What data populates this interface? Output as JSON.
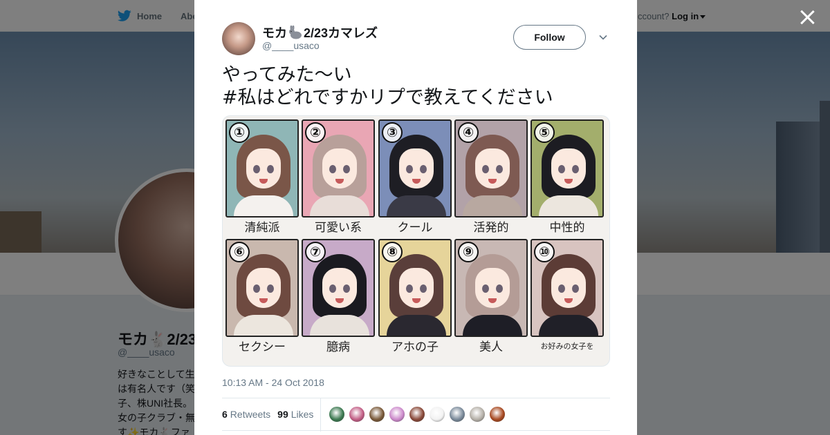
{
  "topbar": {
    "home_label": "Home",
    "about_label": "Abo",
    "login_prompt": "ccount?",
    "login_label": "Log in"
  },
  "profile": {
    "name": "モカ🐇2/23",
    "handle": "@____usaco",
    "bio_lines": [
      "好きなことして生",
      "は有名人です（笑",
      "子、株UNI社長。",
      "女の子クラブ・無",
      "す✨モカ🐇ファ"
    ]
  },
  "tweet": {
    "author_name_prefix": "モカ",
    "author_name_suffix": "2/23カマレズ",
    "author_handle": "@____usaco",
    "follow_label": "Follow",
    "text_line1": "やってみた〜い",
    "text_line2": "#私はどれですかリプで教えてください",
    "timestamp": "10:13 AM - 24 Oct 2018",
    "retweets_count": "6",
    "retweets_label": "Retweets",
    "likes_count": "99",
    "likes_label": "Likes"
  },
  "media": {
    "panels": [
      {
        "num": "①",
        "caption": "清純派",
        "hair": "#7a5648",
        "body": "#f4f1ee",
        "bg": "#8fb6b6"
      },
      {
        "num": "②",
        "caption": "可愛い系",
        "hair": "#b8a09a",
        "body": "#e8ddd8",
        "bg": "#e9a6b4"
      },
      {
        "num": "③",
        "caption": "クール",
        "hair": "#1e1e24",
        "body": "#3a3a46",
        "bg": "#7c8eb8"
      },
      {
        "num": "④",
        "caption": "活発的",
        "hair": "#7e5a52",
        "body": "#b8a8a0",
        "bg": "#b2a2a8"
      },
      {
        "num": "⑤",
        "caption": "中性的",
        "hair": "#1c1c22",
        "body": "#ece6de",
        "bg": "#a3ae6c"
      },
      {
        "num": "⑥",
        "caption": "セクシー",
        "hair": "#6e4a40",
        "body": "#ece6de",
        "bg": "#c9b8ae"
      },
      {
        "num": "⑦",
        "caption": "臆病",
        "hair": "#1a1a20",
        "body": "#e8e2dc",
        "bg": "#c7aac8"
      },
      {
        "num": "⑧",
        "caption": "アホの子",
        "hair": "#5a3e3a",
        "body": "#2a2830",
        "bg": "#e6d49a"
      },
      {
        "num": "⑨",
        "caption": "美人",
        "hair": "#b49c96",
        "body": "#1e1e26",
        "bg": "#c8b8b4"
      },
      {
        "num": "⑩",
        "caption": "お好みの女子を",
        "hair": "#5c3c36",
        "body": "#202028",
        "bg": "#d8c4c0"
      }
    ]
  },
  "liker_colors": [
    "#3d7a52",
    "#c25f86",
    "#7a5a3a",
    "#cc8acb",
    "#8a4a3a",
    "#f2f2f2",
    "#7a8a9a",
    "#b5b0a8",
    "#a84a22"
  ],
  "colors": {
    "accent": "#1da1f2",
    "text": "#14171a",
    "muted": "#657786"
  }
}
